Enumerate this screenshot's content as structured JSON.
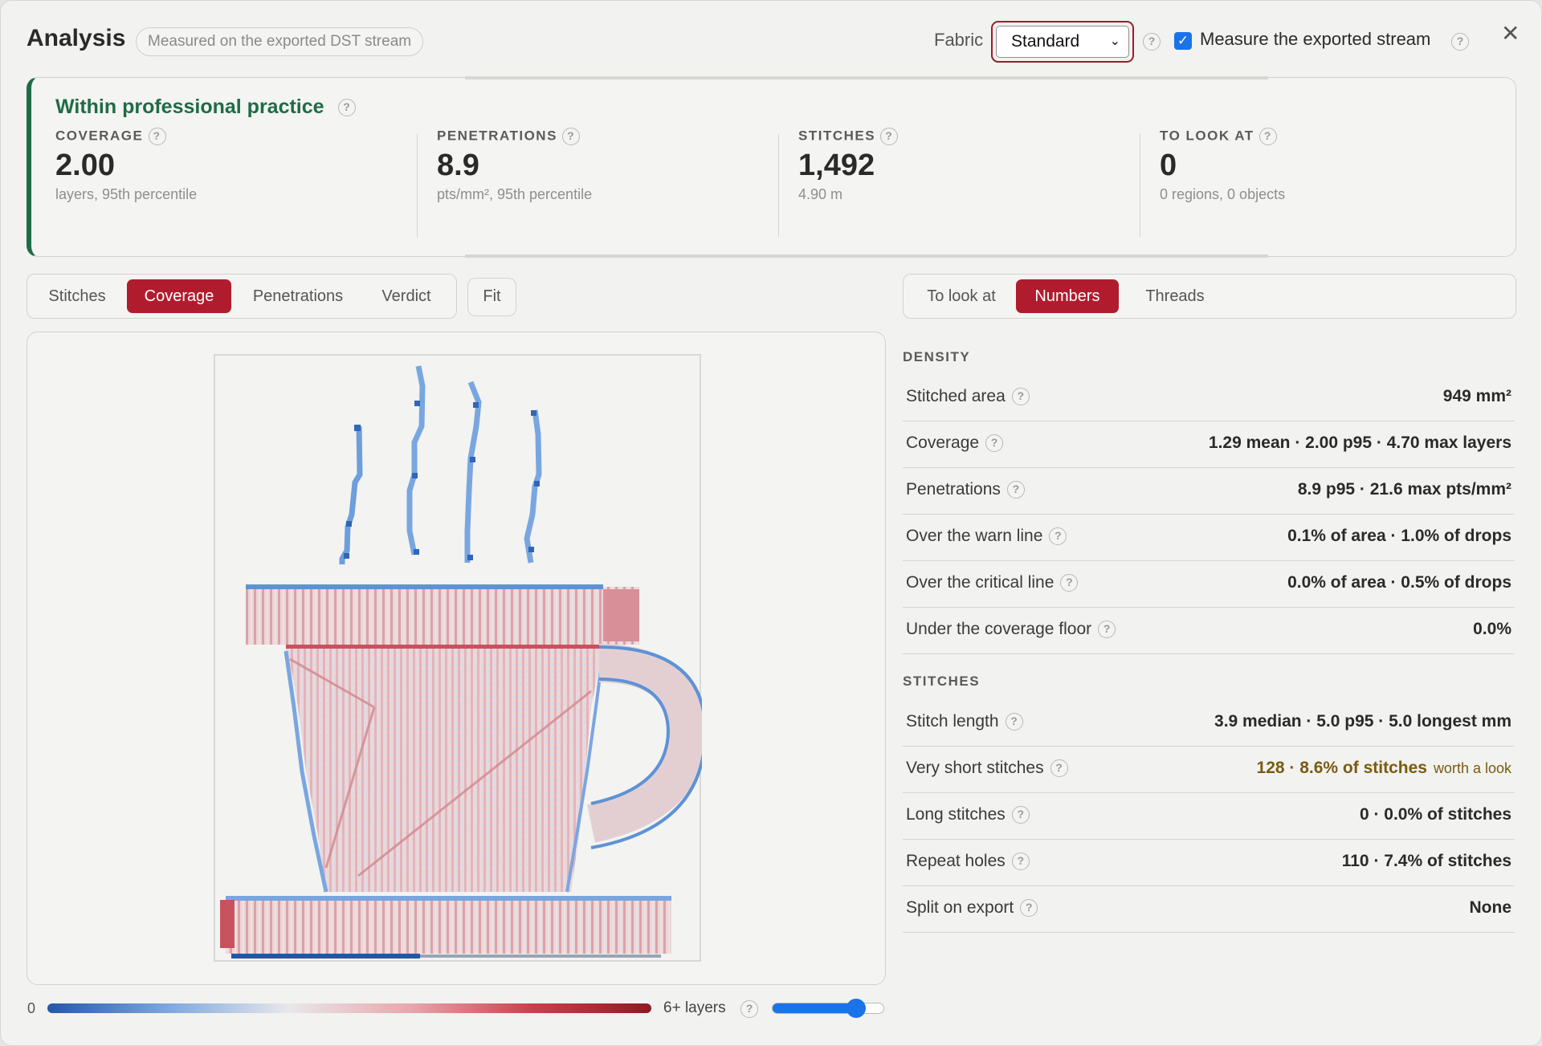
{
  "header": {
    "title": "Analysis",
    "source_pill": "Measured on the exported DST stream",
    "fabric_label": "Fabric",
    "fabric_value": "Standard",
    "measure_label": "Measure the exported stream",
    "measure_checked": true,
    "help": "?",
    "close": "✕"
  },
  "summary": {
    "verdict": "Within professional practice",
    "metrics": [
      {
        "label": "COVERAGE",
        "value": "2.00",
        "sub": "layers, 95th percentile"
      },
      {
        "label": "PENETRATIONS",
        "value": "8.9",
        "sub": "pts/mm², 95th percentile"
      },
      {
        "label": "STITCHES",
        "value": "1,492",
        "sub": "4.90 m"
      },
      {
        "label": "TO LOOK AT",
        "value": "0",
        "sub": "0 regions, 0 objects"
      }
    ]
  },
  "view_tabs": {
    "items": [
      "Stitches",
      "Coverage",
      "Penetrations",
      "Verdict"
    ],
    "active": "Coverage",
    "fit": "Fit"
  },
  "panel_tabs": {
    "items": [
      "To look at",
      "Numbers",
      "Threads"
    ],
    "active": "Numbers"
  },
  "legend": {
    "min": "0",
    "max": "6+ layers",
    "slider_value": 0.76
  },
  "density": {
    "heading": "DENSITY",
    "rows": [
      {
        "label": "Stitched area",
        "value": "949 mm²"
      },
      {
        "label": "Coverage",
        "value": "1.29 mean · 2.00 p95 · 4.70 max layers"
      },
      {
        "label": "Penetrations",
        "value": "8.9 p95 · 21.6 max pts/mm²"
      },
      {
        "label": "Over the warn line",
        "value": "0.1% of area · 1.0% of drops"
      },
      {
        "label": "Over the critical line",
        "value": "0.0% of area · 0.5% of drops"
      },
      {
        "label": "Under the coverage floor",
        "value": "0.0%"
      }
    ]
  },
  "stitches": {
    "heading": "STITCHES",
    "rows": [
      {
        "label": "Stitch length",
        "value": "3.9 median · 5.0 p95 · 5.0 longest mm"
      },
      {
        "label": "Very short stitches",
        "value": "128 · 8.6% of stitches",
        "note": "worth a look"
      },
      {
        "label": "Long stitches",
        "value": "0 · 0.0% of stitches"
      },
      {
        "label": "Repeat holes",
        "value": "110 · 7.4% of stitches"
      },
      {
        "label": "Split on export",
        "value": "None"
      }
    ]
  },
  "colors": {
    "accent": "#b01c2e",
    "verdict_green": "#1f6b45",
    "checkbox_blue": "#1a73e8",
    "warn": "#7a5a10"
  }
}
